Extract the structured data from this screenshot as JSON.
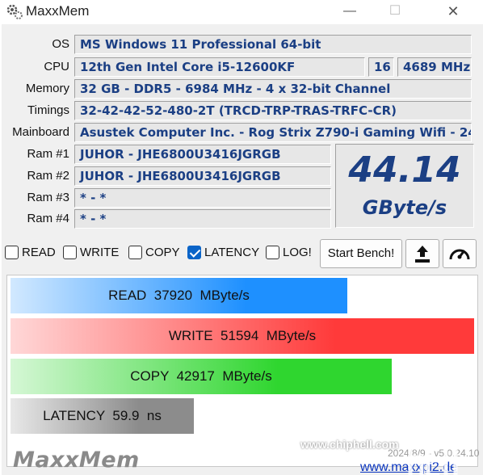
{
  "window": {
    "title": "MaxxMem",
    "min_glyph": "—",
    "max_glyph": "☐",
    "close_glyph": "✕",
    "icon": "gear-app-icon"
  },
  "info": {
    "os_label": "OS",
    "os_value": "MS Windows 11 Professional 64-bit",
    "cpu_label": "CPU",
    "cpu_value": "12th Gen Intel Core i5-12600KF",
    "cpu_threads": "16",
    "cpu_clock": "4689 MHz",
    "memory_label": "Memory",
    "memory_value": "32 GB - DDR5 - 6984 MHz - 4 x 32-bit Channel",
    "timings_label": "Timings",
    "timings_value": "32-42-42-52-480-2T (TRCD-TRP-TRAS-TRFC-CR)",
    "mainboard_label": "Mainboard",
    "mainboard_value": "Asustek Computer Inc. - Rog Strix Z790-i Gaming Wifi - 24",
    "ram1_label": "Ram #1",
    "ram1_value": "JUHOR - JHE6800U3416JGRGB",
    "ram2_label": "Ram #2",
    "ram2_value": "JUHOR - JHE6800U3416JGRGB",
    "ram3_label": "Ram #3",
    "ram3_value": "* - *",
    "ram4_label": "Ram #4",
    "ram4_value": "* - *"
  },
  "score": {
    "value": "44.14",
    "unit": "GByte/s"
  },
  "options": {
    "read_label": "READ",
    "read_checked": false,
    "write_label": "WRITE",
    "write_checked": false,
    "copy_label": "COPY",
    "copy_checked": false,
    "latency_label": "LATENCY",
    "latency_checked": true,
    "log_label": "LOG!",
    "log_checked": false,
    "start_label": "Start Bench!",
    "upload_icon": "upload-icon",
    "gauge_icon": "gauge-icon"
  },
  "results": {
    "read": {
      "name": "READ",
      "value": "37920",
      "unit": "MByte/s",
      "fill": 0.726,
      "color": "#1e90ff"
    },
    "write": {
      "name": "WRITE",
      "value": "51594",
      "unit": "MByte/s",
      "fill": 1.0,
      "color": "#ff3a3a"
    },
    "copy": {
      "name": "COPY",
      "value": "42917",
      "unit": "MByte/s",
      "fill": 0.822,
      "color": "#2fd62f"
    },
    "latency": {
      "name": "LATENCY",
      "value": "59.9",
      "unit": "ns",
      "fill": 0.395,
      "color": "#8c8c8c"
    }
  },
  "footer": {
    "logo_text": "MaxxMem",
    "version": "2024/8/9 - v5.0.24.10",
    "link": "www.maxxpi2.de",
    "watermark": "www.chiphell.com"
  }
}
